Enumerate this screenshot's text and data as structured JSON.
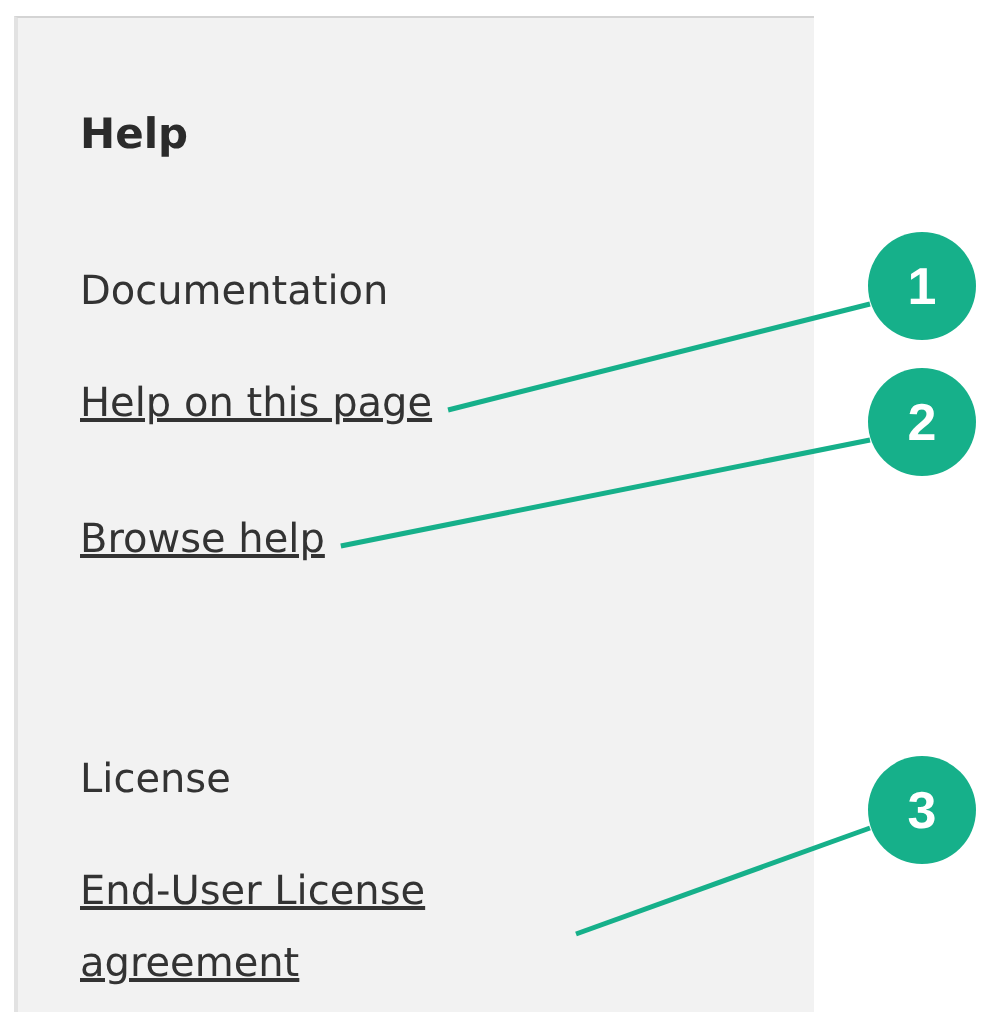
{
  "panel": {
    "title": "Help",
    "sections": [
      {
        "heading": "Documentation",
        "links": [
          {
            "text": "Help on this page",
            "callout": "1"
          },
          {
            "text": "Browse help",
            "callout": "2"
          }
        ]
      },
      {
        "heading": "License",
        "links": [
          {
            "text": "End-User License agreement",
            "callout": "3"
          }
        ]
      }
    ]
  }
}
